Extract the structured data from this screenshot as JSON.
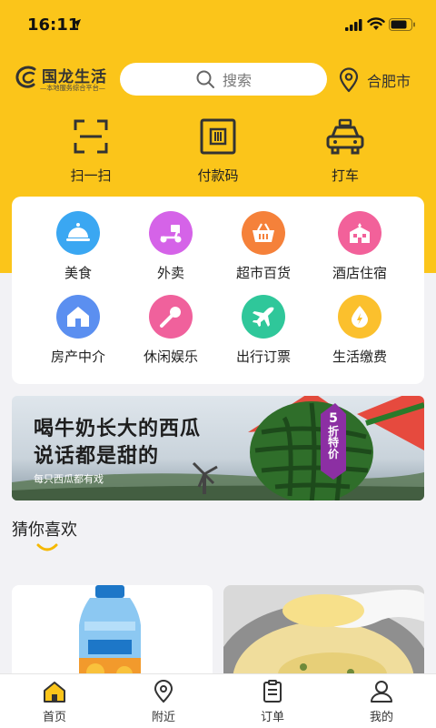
{
  "status_bar": {
    "time": "16:11"
  },
  "header": {
    "logo_title": "国龙生活",
    "logo_subtitle": "—本地服务综合平台—",
    "search_placeholder": "搜索",
    "city": "合肥市"
  },
  "quick_actions": [
    {
      "icon": "scan-icon",
      "label": "扫一扫"
    },
    {
      "icon": "barcode-icon",
      "label": "付款码"
    },
    {
      "icon": "taxi-icon",
      "label": "打车"
    }
  ],
  "categories": [
    {
      "icon": "food-cloche-icon",
      "label": "美食",
      "color": "#3aa7f2"
    },
    {
      "icon": "delivery-scooter-icon",
      "label": "外卖",
      "color": "#d563e8"
    },
    {
      "icon": "shopping-basket-icon",
      "label": "超市百货",
      "color": "#f5813a"
    },
    {
      "icon": "hotel-icon",
      "label": "酒店住宿",
      "color": "#f2619a"
    },
    {
      "icon": "house-icon",
      "label": "房产中介",
      "color": "#5b8ff0"
    },
    {
      "icon": "microphone-icon",
      "label": "休闲娱乐",
      "color": "#f0619c"
    },
    {
      "icon": "airplane-icon",
      "label": "出行订票",
      "color": "#2fc79a"
    },
    {
      "icon": "lightning-drop-icon",
      "label": "生活缴费",
      "color": "#fbc02d"
    }
  ],
  "banner": {
    "title_line1": "喝牛奶长大的西瓜",
    "title_line2": "说话都是甜的",
    "subtitle": "每只西瓜都有戏",
    "tag_line1": "5",
    "tag_line2": "折",
    "tag_line3": "特价"
  },
  "recommend": {
    "title": "猜你喜欢"
  },
  "tabs": [
    {
      "icon": "home-icon",
      "label": "首页"
    },
    {
      "icon": "location-pin-icon",
      "label": "附近"
    },
    {
      "icon": "clipboard-icon",
      "label": "订单"
    },
    {
      "icon": "user-icon",
      "label": "我的"
    }
  ],
  "colors": {
    "brand_yellow": "#fbc51a",
    "page_background": "#f2f2f5"
  }
}
